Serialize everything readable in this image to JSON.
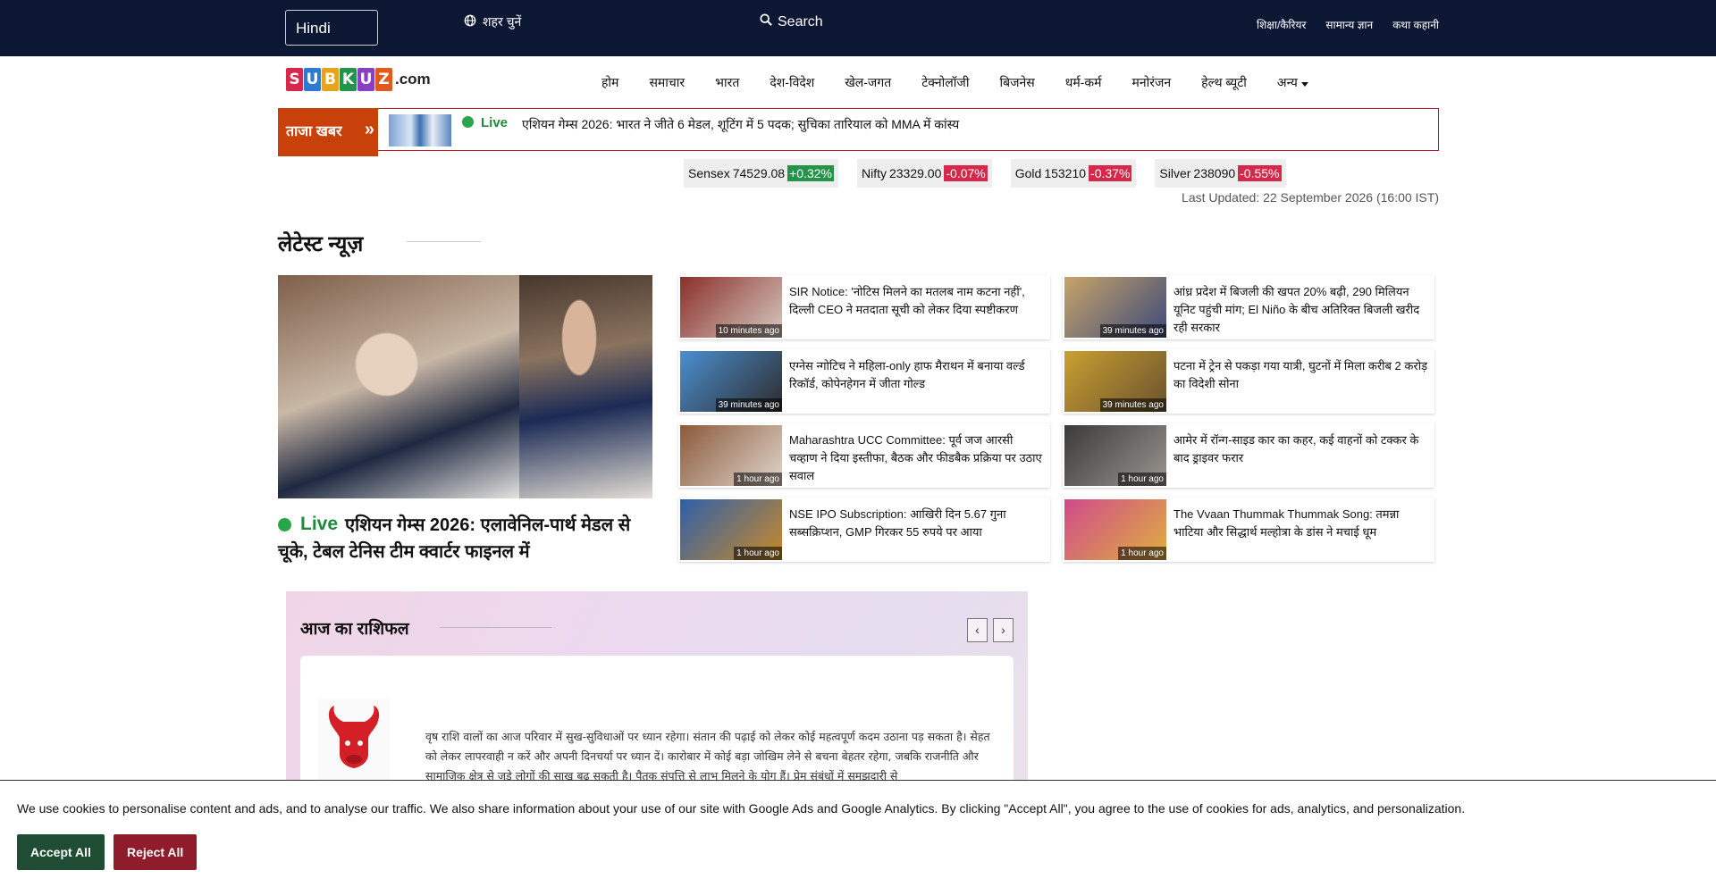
{
  "topbar": {
    "language": "Hindi",
    "city_label": "शहर चुनें",
    "search_label": "Search",
    "links": [
      "शिक्षा/कैरियर",
      "सामान्य ज्ञान",
      "कथा कहानी"
    ]
  },
  "logo": {
    "letters": [
      "S",
      "U",
      "B",
      "K",
      "U",
      "Z"
    ],
    "suffix": ".com"
  },
  "nav": [
    "होम",
    "समाचार",
    "भारत",
    "देश-विदेश",
    "खेल-जगत",
    "टेक्नोलॉजी",
    "बिजनेस",
    "धर्म-कर्म",
    "मनोरंजन",
    "हेल्थ ब्यूटी"
  ],
  "nav_more": "अन्य",
  "ticker": {
    "tag": "ताजा खबर",
    "live": "Live",
    "headline": "एशियन गेम्स 2026: भारत ने जीते 6 मेडल, शूटिंग में 5 पदक; सुचिका तारियाल को MMA में कांस्य"
  },
  "markets": [
    {
      "name": "Sensex",
      "value": "74529.08",
      "change": "+0.32%",
      "dir": "up"
    },
    {
      "name": "Nifty",
      "value": "23329.00",
      "change": "-0.07%",
      "dir": "down"
    },
    {
      "name": "Gold",
      "value": "153210",
      "change": "-0.37%",
      "dir": "down"
    },
    {
      "name": "Silver",
      "value": "238090",
      "change": "-0.55%",
      "dir": "down"
    }
  ],
  "last_updated": "Last Updated: 22 September 2026 (16:00 IST)",
  "latest": {
    "title": "लेटेस्ट न्यूज़",
    "hero": {
      "live": "Live",
      "headline": "एशियन गेम्स 2026: एलावेनिल-पार्थ मेडल से चूके, टेबल टेनिस टीम क्वार्टर फाइनल में"
    },
    "cards": [
      {
        "title": "SIR Notice: 'नोटिस मिलने का मतलब नाम कटना नहीं', दिल्ली CEO ने मतदाता सूची को लेकर दिया स्पष्टीकरण",
        "ago": "10 minutes ago",
        "c1": "#8a2f2a",
        "c2": "#d6c9c0"
      },
      {
        "title": "आंध्र प्रदेश में बिजली की खपत 20% बढ़ी, 290 मिलियन यूनिट पहुंची मांग; El Niño के बीच अतिरिक्त बिजली खरीद रही सरकार",
        "ago": "39 minutes ago",
        "c1": "#c9a46a",
        "c2": "#3b4a7a"
      },
      {
        "title": "एग्नेस न्गोटिच ने महिला-only हाफ मैराथन में बनाया वर्ल्ड रिकॉर्ड, कोपेनहेगन में जीता गोल्ड",
        "ago": "39 minutes ago",
        "c1": "#4c8fd0",
        "c2": "#2b2b2b"
      },
      {
        "title": "पटना में ट्रेन से पकड़ा गया यात्री, घुटनों में मिला करीब 2 करोड़ का विदेशी सोना",
        "ago": "39 minutes ago",
        "c1": "#c9a030",
        "c2": "#6a5130"
      },
      {
        "title": "Maharashtra UCC Committee: पूर्व जज आरसी चव्हाण ने दिया इस्तीफा, बैठक और फीडबैक प्रक्रिया पर उठाए सवाल",
        "ago": "1 hour ago",
        "c1": "#8b5a3a",
        "c2": "#e0d6cc"
      },
      {
        "title": "आमेर में रॉन्ग-साइड कार का कहर, कई वाहनों को टक्कर के बाद ड्राइवर फरार",
        "ago": "1 hour ago",
        "c1": "#3a3a3a",
        "c2": "#9a9590"
      },
      {
        "title": "NSE IPO Subscription: आखिरी दिन 5.67 गुना सब्सक्रिप्शन, GMP गिरकर 55 रुपये पर आया",
        "ago": "1 hour ago",
        "c1": "#2f5fa8",
        "c2": "#c98a2a"
      },
      {
        "title": "The Vvaan Thummak Thummak Song: तमन्ना भाटिया और सिद्धार्थ मल्होत्रा के डांस ने मचाई धूम",
        "ago": "1 hour ago",
        "c1": "#d04a8a",
        "c2": "#e0b040"
      }
    ]
  },
  "rashifal": {
    "title": "आज का राशिफल",
    "text": "वृष राशि वालों का आज परिवार में सुख-सुविधाओं पर ध्यान रहेगा। संतान की पढ़ाई को लेकर कोई महत्वपूर्ण कदम उठाना पड़ सकता है। सेहत को लेकर लापरवाही न करें और अपनी दिनचर्या पर ध्यान दें। कारोबार में कोई बड़ा जोखिम लेने से बचना बेहतर रहेगा, जबकि राजनीति और सामाजिक क्षेत्र से जुड़े लोगों की साख बढ़ सकती है। पैतृक संपत्ति से लाभ मिलने के योग हैं। प्रेम संबंधों में समझदारी से"
  },
  "cookie": {
    "text": "We use cookies to personalise content and ads, and to analyse our traffic. We also share information about your use of our site with Google Ads and Google Analytics. By clicking \"Accept All\", you agree to the use of cookies for ads, analytics, and personalization.",
    "accept": "Accept All",
    "reject": "Reject All"
  },
  "colors": {
    "topbar": "#0b1733",
    "ticker_tag": "#c8410b",
    "ticker_border": "#c0152d",
    "up": "#23944a",
    "down": "#d6284b",
    "live": "#1f8a3b",
    "accept": "#1e4d33",
    "reject": "#8f1c2a",
    "logo_blocks": [
      "#d6284b",
      "#2d7bd1",
      "#e8a21b",
      "#23944a",
      "#8a3fc2",
      "#e05a1b"
    ]
  }
}
